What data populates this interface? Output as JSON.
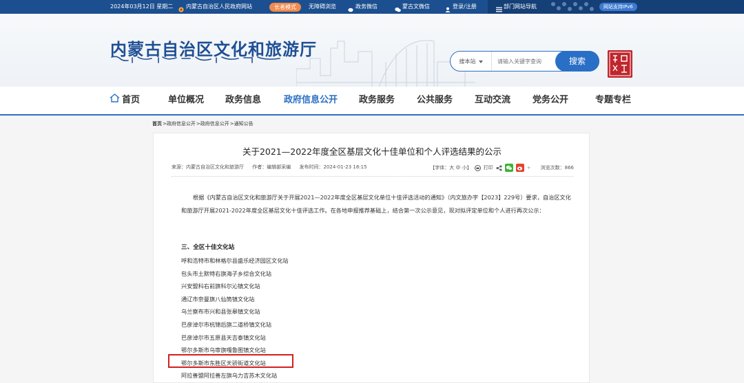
{
  "topbar": {
    "date": "2024年03月12日 星期二",
    "gov_site": "内蒙古自治区人民政府网站",
    "elder_mode": "长者模式",
    "accessible": "无障碍浏览",
    "weibo": "政务微信",
    "wechat": "蒙古文微信",
    "login": "登录/注册",
    "dept_nav": "部门网站导航",
    "ipv6": "网站支持IPv6"
  },
  "header": {
    "title": "内蒙古自治区文化和旅游厅",
    "search_scope": "搜本站",
    "search_placeholder": "请输入关键字查询",
    "search_button": "搜索"
  },
  "nav": [
    {
      "label": "首页"
    },
    {
      "label": "单位概况"
    },
    {
      "label": "政务信息"
    },
    {
      "label": "政府信息公开"
    },
    {
      "label": "政务服务"
    },
    {
      "label": "公共服务"
    },
    {
      "label": "互动交流"
    },
    {
      "label": "党务公开"
    },
    {
      "label": "专题专栏"
    }
  ],
  "breadcrumb": [
    "首页",
    ">政府信息公开",
    ">政府信息公开",
    ">通知公告"
  ],
  "article": {
    "title": "关于2021—2022年度全区基层文化十佳单位和个人评选结果的公示",
    "source": "来源：内蒙古自治区文化和旅游厅",
    "author": "作者：编辑部采编",
    "date": "发布时间：2024-01-23 18:15",
    "font_size": "【字体：大 中 小】",
    "print": "打印",
    "views": "浏览次数：866",
    "intro": "根据《内蒙古自治区文化和旅游厅关于开展2021—2022年度全区基层文化单位十佳评选活动的通知》（内文旅办字【2023】229号）要求，自治区文化和旅游厅开展2021-2022年度全区基层文化十佳评选工作。在各地申报推荐基础上，结合第一次公示意见，现对拟评定单位和个人进行再次公示：",
    "section_title": "三、全区十佳文化站",
    "stations": [
      "呼和浩特市和林格尔县盛乐经济园区文化站",
      "包头市土默特右旗海子乡综合文化站",
      "兴安盟科右前旗科尔沁镇文化站",
      "通辽市奈曼旗八仙筒镇文化站",
      "乌兰察布市兴和县张皋镇文化站",
      "巴彦淖尔市杭锦后旗二道桥镇文化站",
      "巴彦淖尔市五原县天吉泰镇文化站",
      "鄂尔多斯市乌审旗嘎鲁图镇文化站",
      "鄂尔多斯市东胜区天骄街道文化站",
      "阿拉善盟阿拉善左旗乌力吉苏木文化站"
    ]
  }
}
